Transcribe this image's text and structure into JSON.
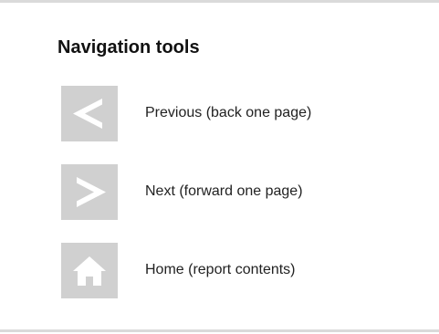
{
  "panel": {
    "title": "Navigation tools"
  },
  "nav": {
    "items": [
      {
        "label": "Previous (back one page)",
        "icon": "chevron-left-icon"
      },
      {
        "label": "Next (forward one page)",
        "icon": "chevron-right-icon"
      },
      {
        "label": "Home (report contents)",
        "icon": "home-icon"
      }
    ]
  },
  "colors": {
    "icon_background": "#d0d0d0",
    "icon_glyph": "#ffffff",
    "rule": "#dadada",
    "text": "#222222"
  }
}
